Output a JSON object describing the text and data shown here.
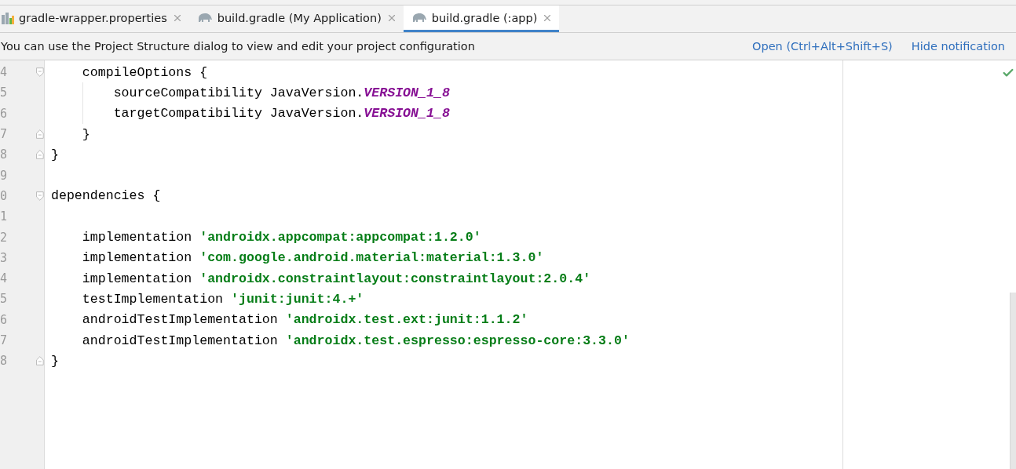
{
  "tabs": [
    {
      "label": "gradle-wrapper.properties",
      "selected": false
    },
    {
      "label": "build.gradle (My Application)",
      "selected": false
    },
    {
      "label": "build.gradle (:app)",
      "selected": true
    }
  ],
  "notification": {
    "message": "You can use the Project Structure dialog to view and edit your project configuration",
    "actions": [
      "Open (Ctrl+Alt+Shift+S)",
      "Hide notification"
    ]
  },
  "editor": {
    "lines": [
      {
        "number": "4",
        "kind": "fold-start",
        "guide": false,
        "tokens": [
          {
            "kind": "plain",
            "text": "    compileOptions {"
          }
        ]
      },
      {
        "number": "5",
        "kind": "plain",
        "guide": true,
        "tokens": [
          {
            "kind": "plain",
            "text": "        sourceCompatibility JavaVersion."
          },
          {
            "kind": "constant",
            "text": "VERSION_1_8"
          }
        ]
      },
      {
        "number": "6",
        "kind": "plain",
        "guide": true,
        "tokens": [
          {
            "kind": "plain",
            "text": "        targetCompatibility JavaVersion."
          },
          {
            "kind": "constant",
            "text": "VERSION_1_8"
          }
        ]
      },
      {
        "number": "7",
        "kind": "fold-end",
        "guide": false,
        "tokens": [
          {
            "kind": "plain",
            "text": "    }"
          }
        ]
      },
      {
        "number": "8",
        "kind": "fold-end",
        "guide": false,
        "tokens": [
          {
            "kind": "plain",
            "text": "}"
          }
        ]
      },
      {
        "number": "9",
        "kind": "plain",
        "guide": false
      },
      {
        "number": "0",
        "kind": "fold-start",
        "guide": false,
        "tokens": [
          {
            "kind": "plain",
            "text": "dependencies {"
          }
        ]
      },
      {
        "number": "1",
        "kind": "plain",
        "guide": false
      },
      {
        "number": "2",
        "kind": "plain",
        "guide": false,
        "tokens": [
          {
            "kind": "plain",
            "text": "    implementation "
          },
          {
            "kind": "string",
            "text": "'androidx.appcompat:appcompat:1.2.0'"
          }
        ]
      },
      {
        "number": "3",
        "kind": "plain",
        "guide": false,
        "tokens": [
          {
            "kind": "plain",
            "text": "    implementation "
          },
          {
            "kind": "string",
            "text": "'com.google.android.material:material:1.3.0'"
          }
        ]
      },
      {
        "number": "4",
        "kind": "plain",
        "guide": false,
        "tokens": [
          {
            "kind": "plain",
            "text": "    implementation "
          },
          {
            "kind": "string",
            "text": "'androidx.constraintlayout:constraintlayout:2.0.4'"
          }
        ]
      },
      {
        "number": "5",
        "kind": "plain",
        "guide": false,
        "tokens": [
          {
            "kind": "plain",
            "text": "    testImplementation "
          },
          {
            "kind": "string",
            "text": "'junit:junit:4.+'"
          }
        ]
      },
      {
        "number": "6",
        "kind": "plain",
        "guide": false,
        "tokens": [
          {
            "kind": "plain",
            "text": "    androidTestImplementation "
          },
          {
            "kind": "string",
            "text": "'androidx.test.ext:junit:1.1.2'"
          }
        ]
      },
      {
        "number": "7",
        "kind": "plain",
        "guide": false,
        "tokens": [
          {
            "kind": "plain",
            "text": "    androidTestImplementation "
          },
          {
            "kind": "string",
            "text": "'androidx.test.espresso:espresso-core:3.3.0'"
          }
        ]
      },
      {
        "number": "8",
        "kind": "fold-end",
        "guide": false,
        "tokens": [
          {
            "kind": "plain",
            "text": "}"
          }
        ]
      }
    ]
  }
}
